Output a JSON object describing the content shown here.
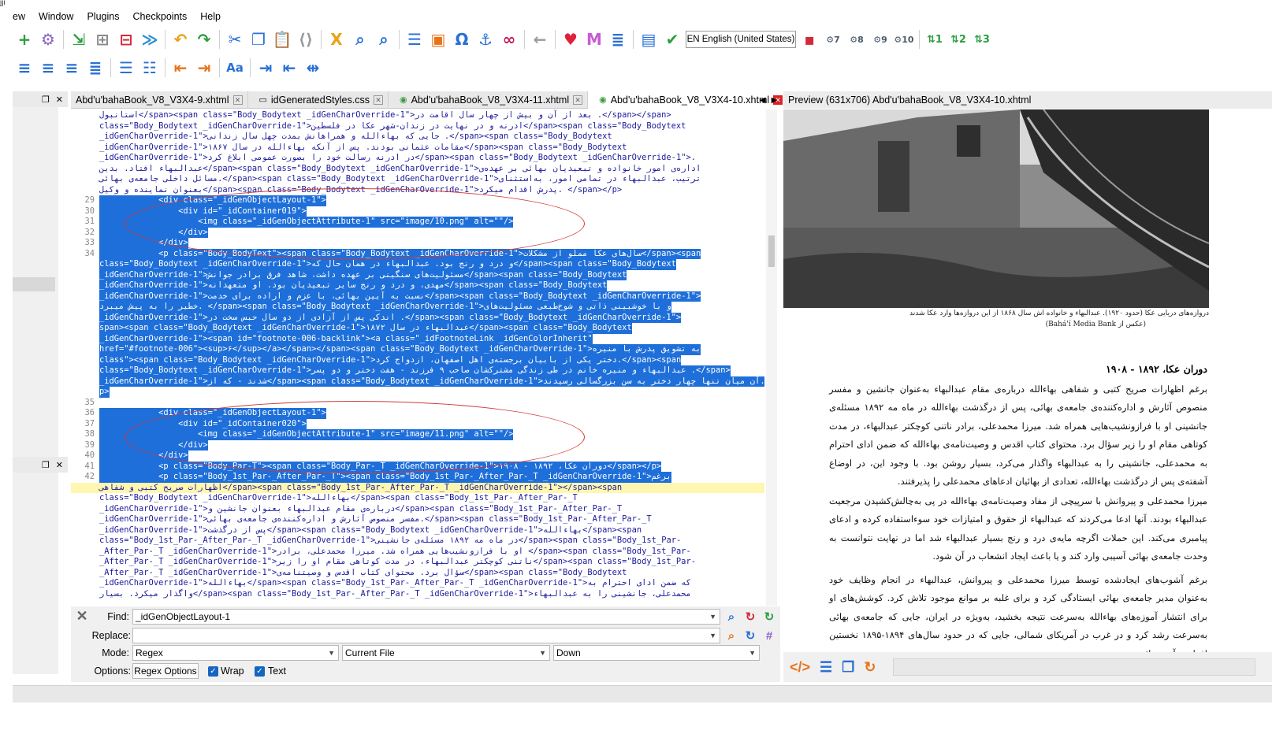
{
  "menu": {
    "topglyph": "jji",
    "items": [
      "ew",
      "Window",
      "Plugins",
      "Checkpoints",
      "Help"
    ]
  },
  "toolbar": {
    "language": "EN English (United States)",
    "icons": [
      {
        "name": "add-file-icon",
        "glyph": "+",
        "color": "#2e9e3e"
      },
      {
        "name": "settings-gear-icon",
        "glyph": "⚙",
        "color": "#8a63c7"
      },
      {
        "name": "add-existing-icon",
        "glyph": "⇲",
        "color": "#2e9e3e"
      },
      {
        "name": "add-blank-icon",
        "glyph": "⊞",
        "color": "#8a8a8a"
      },
      {
        "name": "delete-file-icon",
        "glyph": "⊟",
        "color": "#d22a3a"
      },
      {
        "name": "merge-icon",
        "glyph": "≫",
        "color": "#2a8fd4"
      },
      {
        "name": "undo-icon",
        "glyph": "↶",
        "color": "#e8a317"
      },
      {
        "name": "redo-icon",
        "glyph": "↷",
        "color": "#2e9e3e"
      },
      {
        "name": "cut-icon",
        "glyph": "✂",
        "color": "#2a6fd4"
      },
      {
        "name": "copy-icon",
        "glyph": "❐",
        "color": "#2a6fd4"
      },
      {
        "name": "paste-icon",
        "glyph": "📋",
        "color": "#8a8a8a"
      },
      {
        "name": "code-view-icon",
        "glyph": "⟨⟩",
        "color": "#9a9a9a"
      },
      {
        "name": "spellcheck-icon",
        "glyph": "Ⅹ",
        "color": "#e8a317"
      },
      {
        "name": "search-icon",
        "glyph": "⌕",
        "color": "#2a6fd4"
      },
      {
        "name": "search-replace-icon",
        "glyph": "⌕",
        "color": "#2a6fd4"
      },
      {
        "name": "table-of-contents-icon",
        "glyph": "☰",
        "color": "#2a6fd4"
      },
      {
        "name": "insert-image-icon",
        "glyph": "▣",
        "color": "#e8731a"
      },
      {
        "name": "insert-special-char-icon",
        "glyph": "Ω",
        "color": "#2a6fd4"
      },
      {
        "name": "anchor-icon",
        "glyph": "⚓",
        "color": "#2a6fd4"
      },
      {
        "name": "link-icon",
        "glyph": "∞",
        "color": "#c2185b"
      },
      {
        "name": "back-arrow-icon",
        "glyph": "←",
        "color": "#9a9a9a"
      },
      {
        "name": "heart-icon",
        "glyph": "♥",
        "color": "#e0203a"
      },
      {
        "name": "metadata-icon",
        "glyph": "M",
        "color": "#c75bd4"
      },
      {
        "name": "list-icon",
        "glyph": "≣",
        "color": "#2a6fd4"
      },
      {
        "name": "report-icon",
        "glyph": "▤",
        "color": "#2a6fd4"
      },
      {
        "name": "spellcheck-abc-icon",
        "glyph": "✔",
        "color": "#2e9e3e"
      },
      {
        "name": "plugin-1-icon",
        "glyph": "▪",
        "color": "#d22a3a"
      }
    ],
    "plugin_badges": [
      "7",
      "8",
      "9",
      "10"
    ],
    "heading_levels": [
      "1",
      "2",
      "3"
    ]
  },
  "tabs": [
    {
      "label": "Abd'u'bahaBook_V8_V3X4-9.xhtml",
      "icon": "file-icon",
      "active": false
    },
    {
      "label": "idGeneratedStyles.css",
      "icon": "css-file-icon",
      "active": false
    },
    {
      "label": "Abd'u'bahaBook_V8_V3X4-11.xhtml",
      "icon": "chrome-icon",
      "active": false
    },
    {
      "label": "Abd'u'bahaBook_V8_V3X4-10.xhtml",
      "icon": "chrome-icon",
      "active": true
    }
  ],
  "editor": {
    "lines": [
      {
        "n": "",
        "t": "استانبول</span><span class=\"Body_Bodytext _idGenCharOverride-1\">بعد از آن و بیش از چهار سال اقامت در .</span></span>",
        "sel": false
      },
      {
        "n": "",
        "t": "class=\"Body_Bodytext _idGenCharOverride-1\">ادرنه و در نهایت در زندان-شهر عکا در فلسطین</span><span class=\"Body_Bodytext",
        "sel": false
      },
      {
        "n": "",
        "t": "_idGenCharOverride-1\">جایی که بهاءالله و همراهانش بمدت چهل سال زندانی .</span><span class=\"Body_Bodytext",
        "sel": false
      },
      {
        "n": "",
        "t": "_idGenCharOverride-1\">مقامات عثمانی بودند. پس از آنکه بهاءالله در سال ۱۸۶۷</span><span class=\"Body_Bodytext",
        "sel": false
      },
      {
        "n": "",
        "t": "_idGenCharOverride-1\">در ادرنه رسالت خود را بصورت عمومی ابلاغ کرد</span><span class=\"Body_Bodytext _idGenCharOverride-1\">.",
        "sel": false
      },
      {
        "n": "",
        "t": "عبدالبهاء افتاد. بدین</span><span class=\"Body_Bodytext _idGenCharOverride-1\">اداره‌ی امور خانواده و تبعیدیان بهائی بر عهده‌ی",
        "sel": false
      },
      {
        "n": "",
        "t": "مسائل داخلی جامعه‌ی بهائی.</span><span class=\"Body_Bodytext _idGenCharOverride-1\">ترتیب، عبدالبهاء در تمامی امور، به‌استثنای",
        "sel": false
      },
      {
        "n": "",
        "t": "بعنوان نماینده و وکیل</span><span class=\"Body_Bodytext _idGenCharOverride-1\">پدرش اقدام میکرد. </span></p>",
        "sel": false
      },
      {
        "n": "29",
        "t": "            <div class=\"_idGenObjectLayout-1\">",
        "sel": true
      },
      {
        "n": "30",
        "t": "                <div id=\"_idContainer019\">",
        "sel": true
      },
      {
        "n": "31",
        "t": "                    <img class=\"_idGenObjectAttribute-1\" src=\"image/10.png\" alt=\"\"/>",
        "sel": true
      },
      {
        "n": "32",
        "t": "                </div>",
        "sel": true
      },
      {
        "n": "33",
        "t": "            </div>",
        "sel": true
      },
      {
        "n": "34",
        "t": "            <p class=\"Body_BodyText\"><span class=\"Body_Bodytext _idGenCharOverride-1\">سال‌های عکا مملو از مشکلات</span><span",
        "sel": true
      },
      {
        "n": "",
        "t": "class=\"Body_Bodytext _idGenCharOverride-1\">و درد و رنج بود. عبدالبهاء در همان حال که</span><span class=\"Body_Bodytext",
        "sel": true
      },
      {
        "n": "",
        "t": "_idGenCharOverride-1\">مسئولیت‌های سنگینی بر عهده داشت، شاهد فرق برادر جوانش</span><span class=\"Body_Bodytext",
        "sel": true
      },
      {
        "n": "",
        "t": "_idGenCharOverride-1\">مهدی، و درد و رنج سایر تبعیدیان بود. او متعهدانه</span><span class=\"Body_Bodytext",
        "sel": true
      },
      {
        "n": "",
        "t": "_idGenCharOverride-1\">نسبت به آیین بهائی، با عزم و اراده برای خدمت</span><span class=\"Body_Bodytext _idGenCharOverride-1\">",
        "sel": true
      },
      {
        "n": "",
        "t": "خطیر را به پیش میبرد. </span><span class=\"Body_Bodytext _idGenCharOverride-1\">و با خوشبینی ذاتی و شوخ‌طبعی مسئولیت‌های",
        "sel": true
      },
      {
        "n": "",
        "t": "_idGenCharOverride-1\">اندکی پس از آزادی از دو سال حبس سخت در .</span><span class=\"Body_Bodytext _idGenCharOverride-1\">",
        "sel": true
      },
      {
        "n": "",
        "t": "span><span class=\"Body_Bodytext _idGenCharOverride-1\">عبدالبهاء در سال ۱۸۷۲</span><span class=\"Body_Bodytext",
        "sel": true
      },
      {
        "n": "",
        "t": "_idGenCharOverride-1\"><span id=\"footnote-006-backlink\"><a class=\"_idFootnoteLink _idGenColorInherit\"",
        "sel": true
      },
      {
        "n": "",
        "t": "href=\"#footnote-006\"><sup>۶</sup></a></span></span><span class=\"Body_Bodytext _idGenCharOverride-1\">به تشویق پدرش با منیره",
        "sel": true
      },
      {
        "n": "",
        "t": "class\"><span class=\"Body_Bodytext _idGenCharOverride-1\">دختر یکی از بابیان برجسته‌ی اهل اصفهان، ازدواج کرد.</span><span",
        "sel": true
      },
      {
        "n": "",
        "t": "class=\"Body_Bodytext _idGenCharOverride-1\">عبدالبهاء و منیره خانم در طی زندگی مشترکشان صاحب ۹ فرزند - هفت دختر و دو پسر .</span>",
        "sel": true
      },
      {
        "n": "",
        "t": "_idGenCharOverride-1\">شدند - که از</span><span class=\"Body_Bodytext _idGenCharOverride-1\">آن میان تنها چهار دختر به سن بزرگسالی رسیدند.</span>",
        "sel": true
      },
      {
        "n": "",
        "t": "p>",
        "sel": true
      },
      {
        "n": "35",
        "t": "",
        "sel": false
      },
      {
        "n": "36",
        "t": "            <div class=\"_idGenObjectLayout-1\">",
        "sel": true
      },
      {
        "n": "37",
        "t": "                <div id=\"_idContainer020\">",
        "sel": true
      },
      {
        "n": "38",
        "t": "                    <img class=\"_idGenObjectAttribute-1\" src=\"image/11.png\" alt=\"\"/>",
        "sel": true
      },
      {
        "n": "39",
        "t": "                </div>",
        "sel": true
      },
      {
        "n": "40",
        "t": "            </div>",
        "sel": true
      },
      {
        "n": "41",
        "t": "            <p class=\"Body_Par-T\"><span class=\"Body_Par-_T _idGenCharOverride-1\">دوران عکا، ۱۸۹۲ - ۱۹۰۸</span></p>",
        "sel": true
      },
      {
        "n": "42",
        "t": "            <p class=\"Body_1st_Par-_After_Par-_T\"><span class=\"Body_1st_Par-_After_Par-_T _idGenCharOverride-1\">برغم",
        "sel": true
      },
      {
        "n": "",
        "t": "اظهارات صریح کتبی و شفاهی</span><span class=\"Body_1st_Par-_After_Par-_T _idGenCharOverride-1\"></span><span",
        "sel": "hl"
      },
      {
        "n": "",
        "t": "class=\"Body_Bodytext _idGenCharOverride-1\">بهاءالله</span><span class=\"Body_1st_Par-_After_Par-_T",
        "sel": false
      },
      {
        "n": "",
        "t": "_idGenCharOverride-1\">درباره‌ی مقام عبدالبهاء بعنوان جانشین و</span><span class=\"Body_1st_Par-_After_Par-_T",
        "sel": false
      },
      {
        "n": "",
        "t": "_idGenCharOverride-1\">مفسر منصوص آثارش و اداره‌کننده‌ی جامعه‌ی بهائی.</span><span class=\"Body_1st_Par-_After_Par-_T",
        "sel": false
      },
      {
        "n": "",
        "t": "_idGenCharOverride-1\">پس از درگذشت</span><span class=\"Body_Bodytext _idGenCharOverride-1\">بهاءالله</span><span",
        "sel": false
      },
      {
        "n": "",
        "t": "class=\"Body_1st_Par-_After_Par-_T _idGenCharOverride-1\">در ماه مه ۱۸۹۲ مسئله‌ی جانشینی</span><span class=\"Body_1st_Par-",
        "sel": false
      },
      {
        "n": "",
        "t": "_After_Par-_T _idGenCharOverride-1\">او با فرازونشیب‌هایی همراه شد. میرزا محمدعلی، برادر </span><span class=\"Body_1st_Par-",
        "sel": false
      },
      {
        "n": "",
        "t": "_After_Par-_T _idGenCharOverride-1\">ناتنی کوچکتر عبدالبهاء، در مدت کوتاهی مقام او را زیر</span><span class=\"Body_1st_Par-",
        "sel": false
      },
      {
        "n": "",
        "t": "_After_Par-_T _idGenCharOverride-1\">سؤال برد. محتوای کتاب اقدس و وصیتنامه‌ی</span><span class=\"Body_Bodytext",
        "sel": false
      },
      {
        "n": "",
        "t": "_idGenCharOverride-1\">بهاءالله</span><span class=\"Body_1st_Par-_After_Par-_T _idGenCharOverride-1\">که ضمن ادای احترام به",
        "sel": false
      },
      {
        "n": "",
        "t": "واگذار میکرد. بسیار</span><span class=\"Body_1st_Par-_After_Par-_T _idGenCharOverride-1\">محمدعلی، جانشینی را به عبدالبهاء",
        "sel": false
      }
    ]
  },
  "find": {
    "find_label": "Find:",
    "find_value": "_idGenObjectLayout-1",
    "replace_label": "Replace:",
    "replace_value": "",
    "mode_label": "Mode:",
    "mode_value": "Regex",
    "scope_value": "Current File",
    "direction_value": "Down",
    "options_label": "Options:",
    "regex_options_button": "Regex Options",
    "wrap_label": "Wrap",
    "text_label": "Text"
  },
  "preview": {
    "header": "Preview (631x706) Abd'u'bahaBook_V8_V3X4-10.xhtml",
    "caption_line1": "دروازه‌های دریایی عکا (حدود ۱۹۲۰). عبدالبهاء و خانواده اش سال ۱۸۶۸ از این دروازه‌ها وارد عکا شدند",
    "caption_line2": "(عکس از Bahá'í Media Bank)",
    "heading": "دوران عکا، ۱۸۹۲ - ۱۹۰۸",
    "para1": "برغم اظهارات صریح کتبی و شفاهی بهاءالله درباره‌ی مقام عبدالبهاء به‌عنوان جانشین و مفسر منصوص آثارش و اداره‌کننده‌ی جامعه‌ی بهائی، پس از درگذشت بهاءالله در ماه مه ۱۸۹۲ مسئله‌ی جانشینی او با فرازونشیب‌هایی همراه شد. میرزا محمدعلی، برادر ناتنی کوچکتر عبدالبهاء، در مدت کوتاهی مقام او را زیر سؤال برد. محتوای کتاب اقدس و وصیت‌نامه‌ی بهاءالله که ضمن ادای احترام به محمدعلی، جانشینی را به عبدالبهاء واگذار می‌کرد، بسیار روشن بود. با وجود این، در اوضاع آشفته‌ی پس از درگذشت بهاءالله، تعدادی از بهائیان ادعاهای محمدعلی را پذیرفتند.",
    "para2": "میرزا محمدعلی و پیروانش با سرپیچی از مفاد وصیت‌نامه‌ی بهاءالله در پی به‌چالش‌کشیدن مرجعیت عبدالبهاء بودند. آنها ادعا می‌کردند که عبدالبهاء از حقوق و امتیازات خود سوءاستفاده کرده و ادعای پیامبری می‌کند. این حملات اگرچه مایه‌ی درد و رنج بسیار عبدالبهاء شد اما در نهایت نتوانست به وحدت جامعه‌ی بهائی آسیبی وارد کند و یا باعث ایجاد انشعاب در آن شود.",
    "para3": "برغم آشوب‌های ایجادشده توسط میرزا محمدعلی و پیروانش، عبدالبهاء در انجام وظایف خود به‌عنوان مدیر جامعه‌ی بهائی ایستادگی کرد و برای غلبه بر موانع موجود تلاش کرد. کوشش‌های او برای انتشار آموزه‌های بهاءالله به‌سرعت نتیجه بخشید، به‌ویژه در ایران، جایی که جامعه‌ی بهائی به‌سرعت رشد کرد و در غرب در آمریکای شمالی، جایی که در حدود سال‌های ۱۸۹۴-۱۸۹۵ نخستین افراد به آیین بهائی"
  }
}
